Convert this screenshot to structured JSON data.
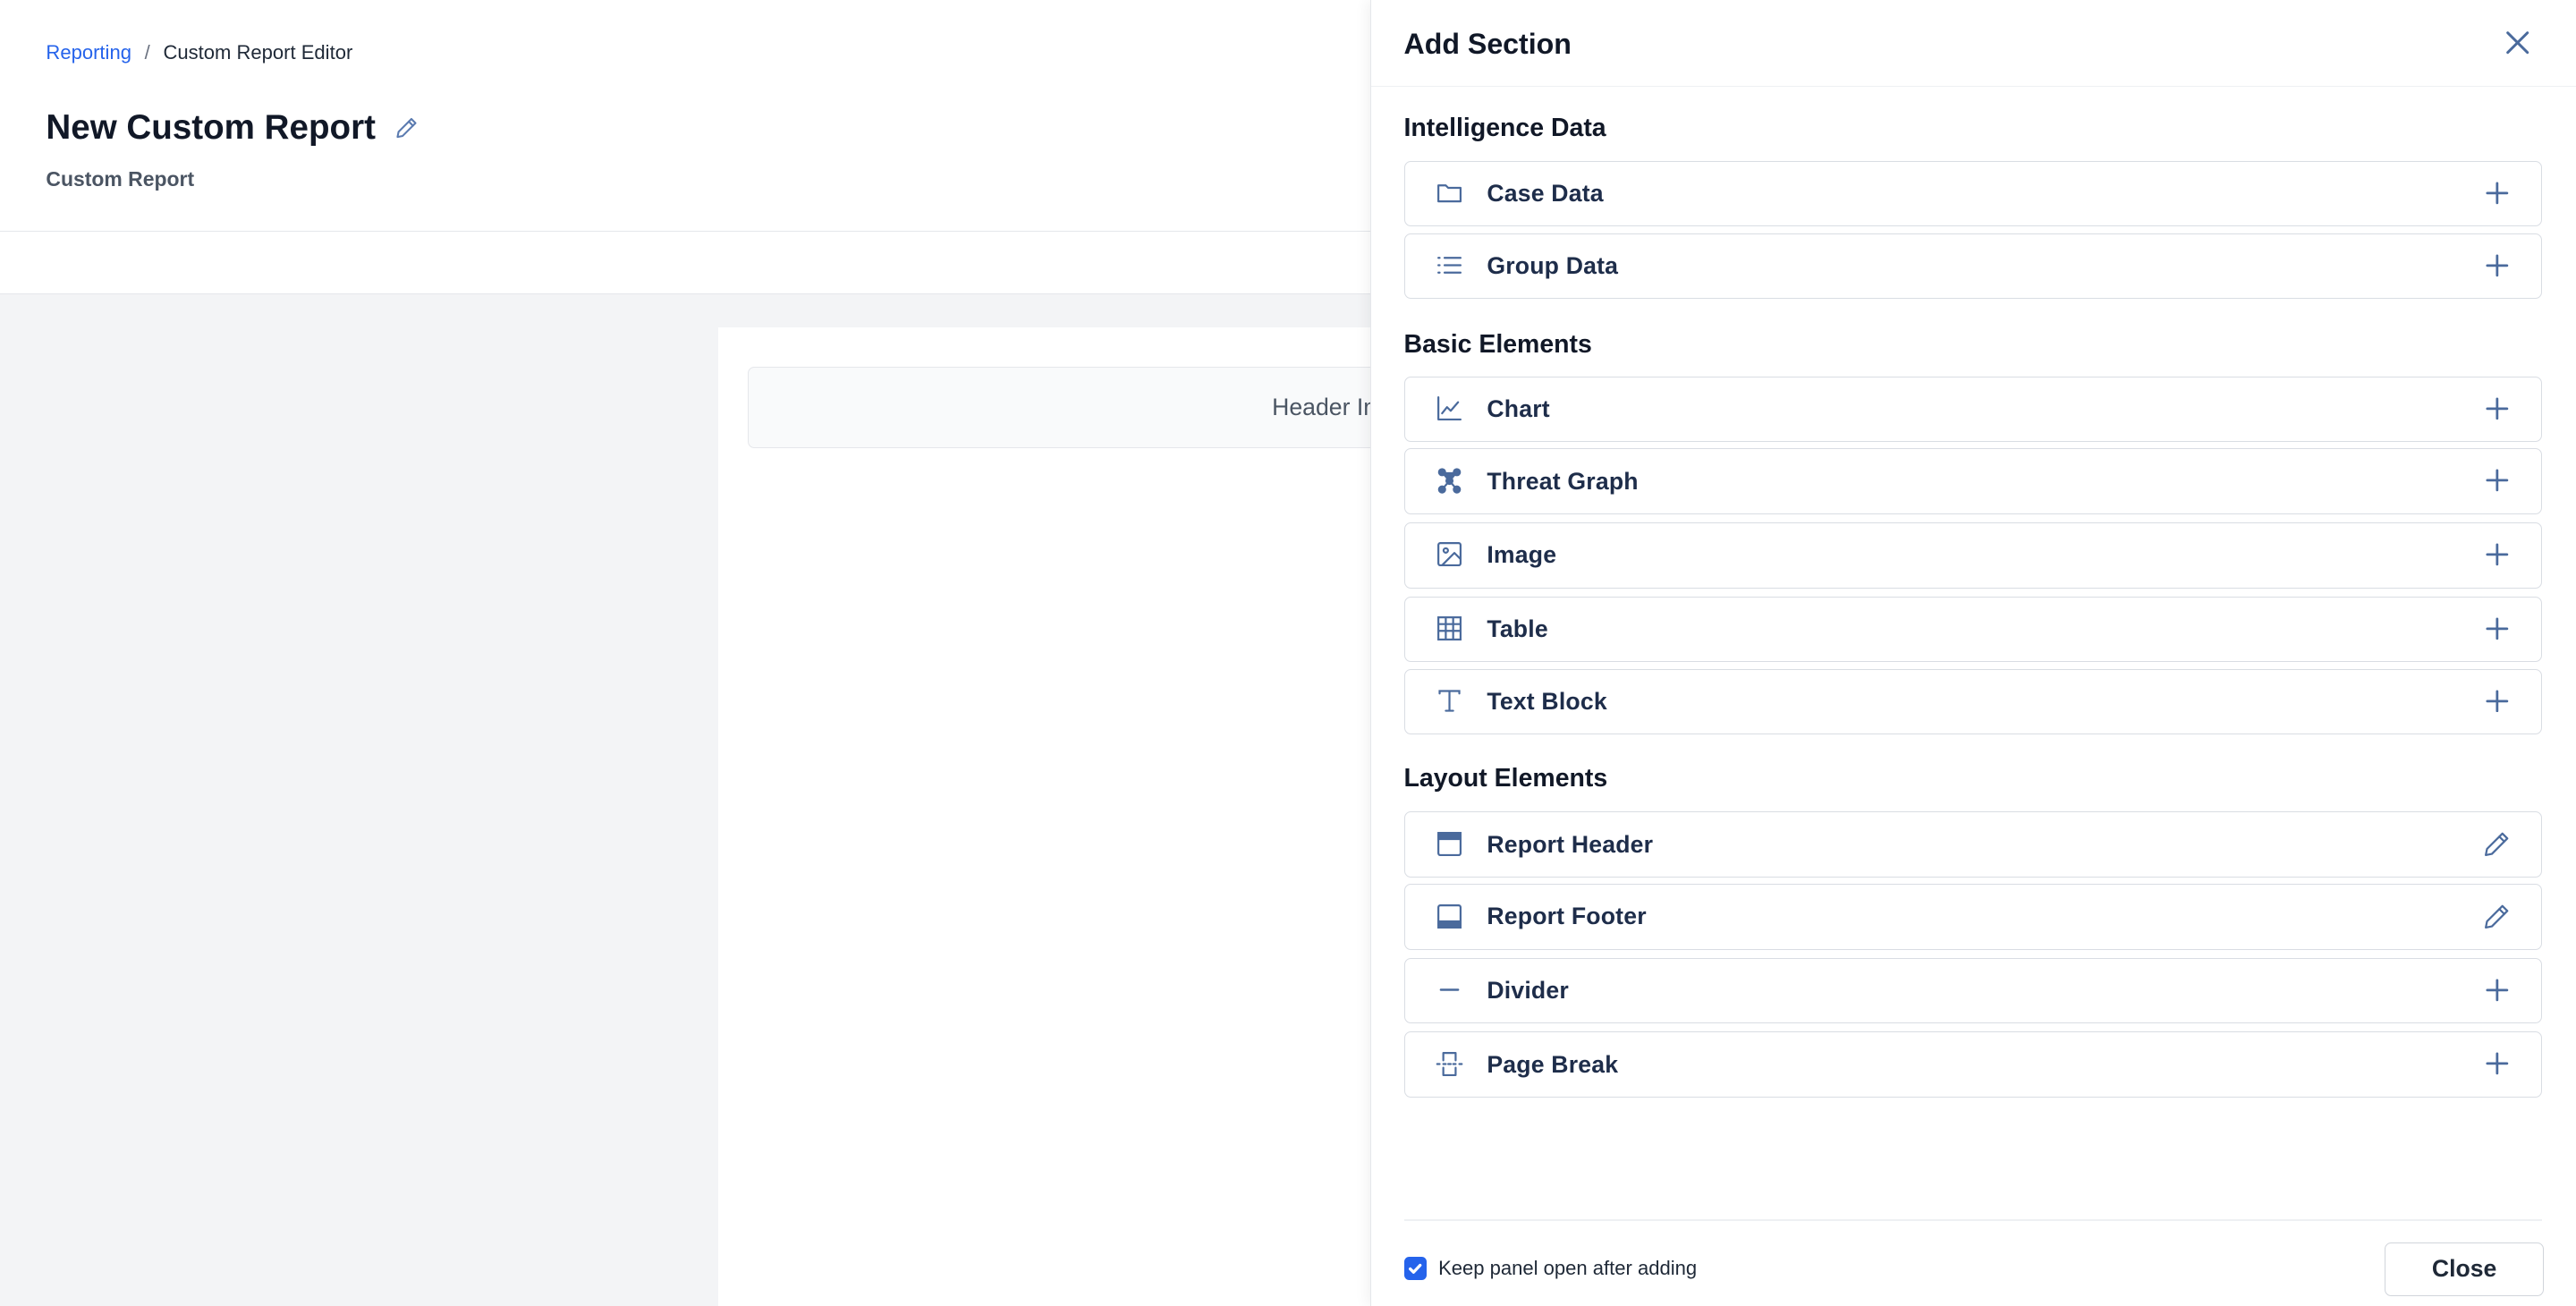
{
  "breadcrumb": {
    "parent": "Reporting",
    "separator": "/",
    "current": "Custom Report Editor"
  },
  "page": {
    "title": "New Custom Report",
    "subtitle": "Custom Report",
    "header_placeholder": "Header Image or T"
  },
  "panel": {
    "title": "Add Section",
    "groups": {
      "intelligence": {
        "title": "Intelligence Data",
        "items": [
          {
            "label": "Case Data",
            "icon": "folder-icon",
            "action": "plus-icon"
          },
          {
            "label": "Group Data",
            "icon": "list-icon",
            "action": "plus-icon"
          }
        ]
      },
      "basic": {
        "title": "Basic Elements",
        "items": [
          {
            "label": "Chart",
            "icon": "line-chart-icon",
            "action": "plus-icon"
          },
          {
            "label": "Threat Graph",
            "icon": "graph-network-icon",
            "action": "plus-icon"
          },
          {
            "label": "Image",
            "icon": "image-icon",
            "action": "plus-icon"
          },
          {
            "label": "Table",
            "icon": "table-icon",
            "action": "plus-icon"
          },
          {
            "label": "Text Block",
            "icon": "text-icon",
            "action": "plus-icon"
          }
        ]
      },
      "layout": {
        "title": "Layout Elements",
        "items": [
          {
            "label": "Report Header",
            "icon": "header-layout-icon",
            "action": "pencil-icon"
          },
          {
            "label": "Report Footer",
            "icon": "footer-layout-icon",
            "action": "pencil-icon"
          },
          {
            "label": "Divider",
            "icon": "divider-icon",
            "action": "plus-icon"
          },
          {
            "label": "Page Break",
            "icon": "page-break-icon",
            "action": "plus-icon"
          }
        ]
      }
    },
    "footer": {
      "keep_open_label": "Keep panel open after adding",
      "keep_open_checked": true,
      "close_label": "Close"
    }
  },
  "colors": {
    "accent": "#2563eb",
    "icon": "#4a6a9c",
    "text": "#1e2d4a",
    "canvas": "#f3f4f6"
  }
}
